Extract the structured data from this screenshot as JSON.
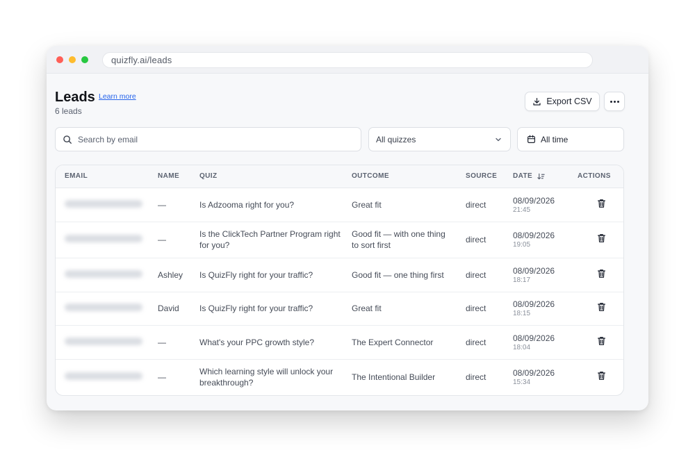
{
  "browser": {
    "url": "quizfly.ai/leads"
  },
  "header": {
    "title": "Leads",
    "learn_more": "Learn more",
    "count": "6 leads"
  },
  "toolbar": {
    "export_label": "Export CSV"
  },
  "filters": {
    "search_placeholder": "Search by email",
    "quiz_select": "All quizzes",
    "time_select": "All time"
  },
  "table": {
    "columns": {
      "email": "EMAIL",
      "name": "NAME",
      "quiz": "QUIZ",
      "outcome": "OUTCOME",
      "source": "SOURCE",
      "date": "DATE",
      "actions": "ACTIONS"
    },
    "rows": [
      {
        "name": "—",
        "quiz": "Is Adzooma right for you?",
        "outcome": "Great fit",
        "source": "direct",
        "date": "08/09/2026",
        "time": "21:45"
      },
      {
        "name": "—",
        "quiz": "Is the ClickTech Partner Program right for you?",
        "outcome": "Good fit — with one thing to sort first",
        "source": "direct",
        "date": "08/09/2026",
        "time": "19:05"
      },
      {
        "name": "Ashley",
        "quiz": "Is QuizFly right for your traffic?",
        "outcome": "Good fit — one thing first",
        "source": "direct",
        "date": "08/09/2026",
        "time": "18:17"
      },
      {
        "name": "David",
        "quiz": "Is QuizFly right for your traffic?",
        "outcome": "Great fit",
        "source": "direct",
        "date": "08/09/2026",
        "time": "18:15"
      },
      {
        "name": "—",
        "quiz": "What's your PPC growth style?",
        "outcome": "The Expert Connector",
        "source": "direct",
        "date": "08/09/2026",
        "time": "18:04"
      },
      {
        "name": "—",
        "quiz": "Which learning style will unlock your breakthrough?",
        "outcome": "The Intentional Builder",
        "source": "direct",
        "date": "08/09/2026",
        "time": "15:34"
      }
    ]
  }
}
